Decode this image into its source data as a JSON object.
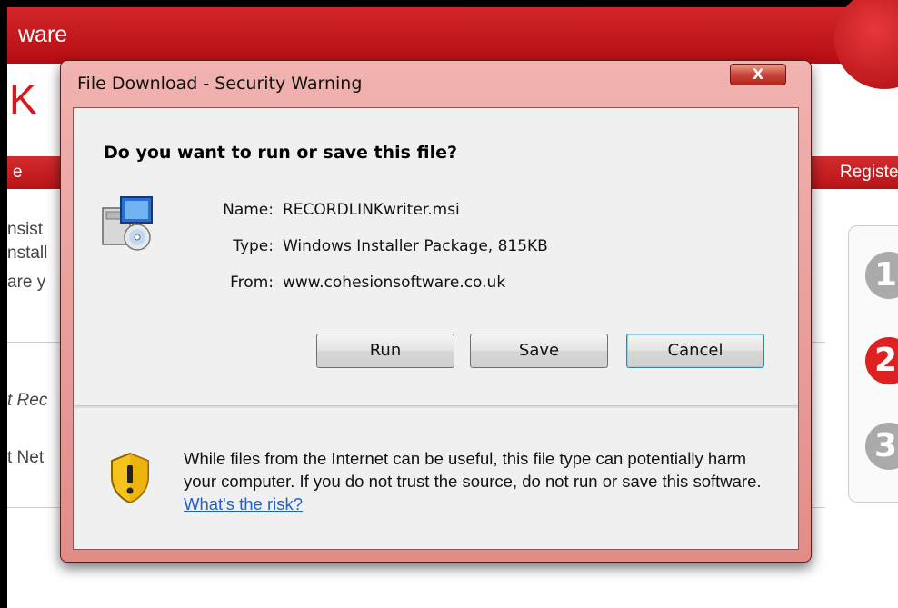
{
  "background": {
    "brand_fragment": "ware",
    "big_letter": "K",
    "nav_left": "e",
    "nav_right": "Registe",
    "text_lines": [
      "nsist",
      "nstall",
      "are y"
    ],
    "italic_text": "t Rec",
    "text_net": "t Net",
    "steps": [
      "1",
      "2",
      "3"
    ]
  },
  "dialog": {
    "title": "File Download - Security Warning",
    "close_glyph": "X",
    "question": "Do you want to run or save this file?",
    "name_label": "Name:",
    "name_value": "RECORDLINKwriter.msi",
    "type_label": "Type:",
    "type_value": "Windows Installer Package, 815KB",
    "from_label": "From:",
    "from_value": "www.cohesionsoftware.co.uk",
    "buttons": {
      "run": "Run",
      "save": "Save",
      "cancel": "Cancel"
    },
    "warning_text": "While files from the Internet can be useful, this file type can potentially harm your computer. If you do not trust the source, do not run or save this software.",
    "warning_link": "What's the risk?"
  },
  "colors": {
    "brand_red": "#c8161c",
    "dialog_frame": "#e99a96",
    "link_blue": "#1f5fcf"
  },
  "icons": [
    "installer-package-icon",
    "shield-warning-icon",
    "close-icon"
  ]
}
